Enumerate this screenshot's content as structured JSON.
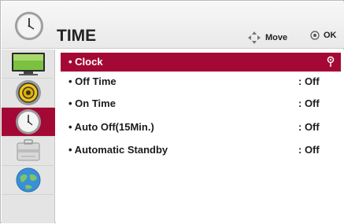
{
  "header": {
    "title": "TIME",
    "hint_move": "Move",
    "hint_ok": "OK",
    "icon": "clock-icon"
  },
  "sidebar": {
    "items": [
      {
        "name": "picture",
        "icon": "tv-screen-icon"
      },
      {
        "name": "audio",
        "icon": "speaker-icon"
      },
      {
        "name": "time",
        "icon": "clock-icon",
        "active": true
      },
      {
        "name": "option",
        "icon": "toolbox-icon"
      },
      {
        "name": "network",
        "icon": "globe-icon"
      }
    ]
  },
  "menu": {
    "items": [
      {
        "label": "• Clock",
        "value": "",
        "selected": true
      },
      {
        "label": "• Off Time",
        "value": ": Off"
      },
      {
        "label": "• On Time",
        "value": ": Off"
      },
      {
        "label": "• Auto Off(15Min.)",
        "value": ": Off"
      },
      {
        "label": "• Automatic Standby",
        "value": ": Off"
      }
    ]
  },
  "colors": {
    "accent": "#a40935",
    "background": "#ffffff",
    "sidebar": "#e4e4e4"
  }
}
